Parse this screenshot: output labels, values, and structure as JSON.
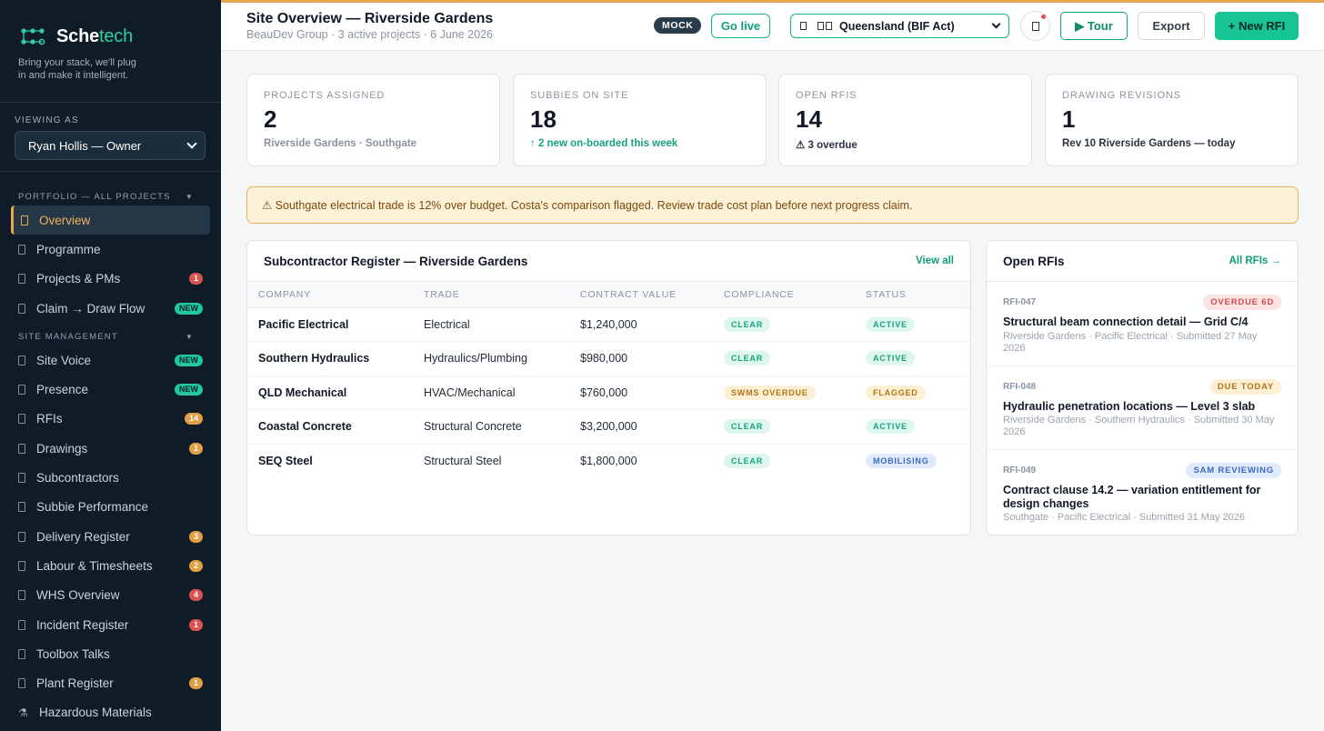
{
  "brand": {
    "name_part1": "Sche",
    "name_part2": "tech",
    "tagline": "Bring your stack, we'll plug in and make it intelligent."
  },
  "viewing": {
    "label": "VIEWING AS",
    "value": "Ryan Hollis — Owner"
  },
  "sidebar": {
    "section1": "PORTFOLIO — ALL PROJECTS",
    "section2": "SITE MANAGEMENT",
    "items": [
      {
        "label": "Overview",
        "badge": ""
      },
      {
        "label": "Programme",
        "badge": ""
      },
      {
        "label": "Projects & PMs",
        "badge": "1"
      },
      {
        "label": "Claim → Draw Flow",
        "badge": "NEW"
      },
      {
        "label": "Site Voice",
        "badge": "NEW"
      },
      {
        "label": "Presence",
        "badge": "NEW"
      },
      {
        "label": "RFIs",
        "badge": "14"
      },
      {
        "label": "Drawings",
        "badge": "1"
      },
      {
        "label": "Subcontractors",
        "badge": ""
      },
      {
        "label": "Subbie Performance",
        "badge": ""
      },
      {
        "label": "Delivery Register",
        "badge": "3"
      },
      {
        "label": "Labour & Timesheets",
        "badge": "2"
      },
      {
        "label": "WHS Overview",
        "badge": "4"
      },
      {
        "label": "Incident Register",
        "badge": "1"
      },
      {
        "label": "Toolbox Talks",
        "badge": ""
      },
      {
        "label": "Plant Register",
        "badge": "1"
      },
      {
        "label": "Hazardous Materials",
        "badge": "",
        "icon": "⚗"
      }
    ]
  },
  "header": {
    "title": "Site Overview — Riverside Gardens",
    "subtitle": "BeauDev Group · 3 active projects · 6 June 2026",
    "mock": "MOCK",
    "go_live": "Go live",
    "region": "Queensland (BIF Act)",
    "tour": "▶ Tour",
    "export": "Export",
    "new_rfi": "+ New RFI"
  },
  "kpis": [
    {
      "label": "PROJECTS ASSIGNED",
      "value": "2",
      "sub": "Riverside Gardens · Southgate"
    },
    {
      "label": "SUBBIES ON SITE",
      "value": "18",
      "sub": "↑ 2 new on-boarded this week"
    },
    {
      "label": "OPEN RFIS",
      "value": "14",
      "sub": "⚠ 3 overdue"
    },
    {
      "label": "DRAWING REVISIONS",
      "value": "1",
      "sub": "Rev 10 Riverside Gardens — today"
    }
  ],
  "alert": "⚠ Southgate electrical trade is 12% over budget. Costa's comparison flagged. Review trade cost plan before next progress claim.",
  "register": {
    "title": "Subcontractor Register — Riverside Gardens",
    "view_all": "View all",
    "columns": [
      "COMPANY",
      "TRADE",
      "CONTRACT VALUE",
      "COMPLIANCE",
      "STATUS"
    ],
    "rows": [
      {
        "company": "Pacific Electrical",
        "trade": "Electrical",
        "value": "$1,240,000",
        "compliance": "CLEAR",
        "status": "ACTIVE"
      },
      {
        "company": "Southern Hydraulics",
        "trade": "Hydraulics/Plumbing",
        "value": "$980,000",
        "compliance": "CLEAR",
        "status": "ACTIVE"
      },
      {
        "company": "QLD Mechanical",
        "trade": "HVAC/Mechanical",
        "value": "$760,000",
        "compliance": "SWMS OVERDUE",
        "status": "FLAGGED"
      },
      {
        "company": "Coastal Concrete",
        "trade": "Structural Concrete",
        "value": "$3,200,000",
        "compliance": "CLEAR",
        "status": "ACTIVE"
      },
      {
        "company": "SEQ Steel",
        "trade": "Structural Steel",
        "value": "$1,800,000",
        "compliance": "CLEAR",
        "status": "MOBILISING"
      }
    ]
  },
  "rfis": {
    "title": "Open RFIs",
    "all_link": "All RFIs →",
    "items": [
      {
        "id": "RFI-047",
        "tag": "OVERDUE 6D",
        "title": "Structural beam connection detail — Grid C/4",
        "meta": "Riverside Gardens · Pacific Electrical · Submitted 27 May 2026"
      },
      {
        "id": "RFI-048",
        "tag": "DUE TODAY",
        "title": "Hydraulic penetration locations — Level 3 slab",
        "meta": "Riverside Gardens · Southern Hydraulics · Submitted 30 May 2026"
      },
      {
        "id": "RFI-049",
        "tag": "SAM REVIEWING",
        "title": "Contract clause 14.2 — variation entitlement for design changes",
        "meta": "Southgate · Pacific Electrical · Submitted 31 May 2026"
      }
    ]
  },
  "colors": {
    "accent": "#17c495",
    "active_nav": "#e8a84f",
    "sidebar_bg": "#0f1c27"
  }
}
